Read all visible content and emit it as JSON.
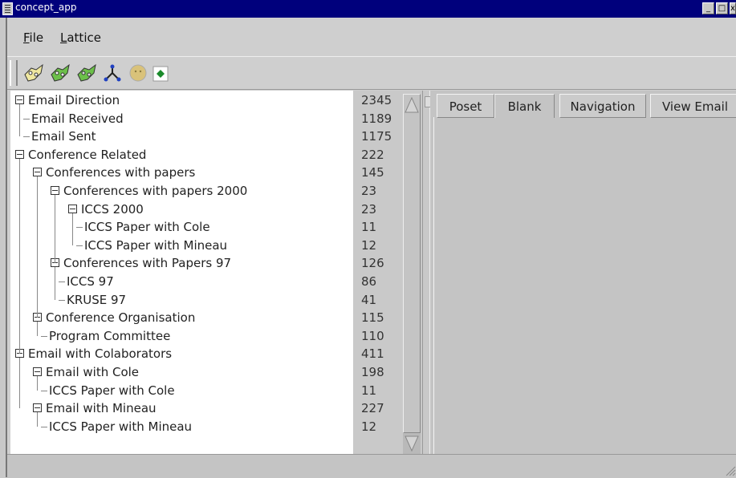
{
  "window": {
    "title": "concept_app"
  },
  "menubar": {
    "items": [
      "File",
      "Lattice"
    ]
  },
  "toolbar": {
    "icons": [
      "open-diagram-icon",
      "open-green-diagram-icon",
      "green-diagram-icon",
      "lattice-icon",
      "blank-face-icon",
      "green-dot-icon"
    ]
  },
  "tree": {
    "rows": [
      {
        "label": "Email Direction",
        "count": "2345"
      },
      {
        "label": "Email Received",
        "count": "1189"
      },
      {
        "label": "Email Sent",
        "count": "1175"
      },
      {
        "label": "Conference Related",
        "count": "222"
      },
      {
        "label": "Conferences with papers",
        "count": "145"
      },
      {
        "label": "Conferences with papers 2000",
        "count": "23"
      },
      {
        "label": "ICCS 2000",
        "count": "23"
      },
      {
        "label": "ICCS Paper with Cole",
        "count": "11"
      },
      {
        "label": "ICCS Paper with Mineau",
        "count": "12"
      },
      {
        "label": "Conferences with Papers 97",
        "count": "126"
      },
      {
        "label": "ICCS 97",
        "count": "86"
      },
      {
        "label": "KRUSE 97",
        "count": "41"
      },
      {
        "label": "Conference Organisation",
        "count": "115"
      },
      {
        "label": "Program Committee",
        "count": "110"
      },
      {
        "label": "Email with Colaborators",
        "count": "411"
      },
      {
        "label": "Email with Cole",
        "count": "198"
      },
      {
        "label": "ICCS Paper with Cole",
        "count": "11"
      },
      {
        "label": "Email with Mineau",
        "count": "227"
      },
      {
        "label": "ICCS Paper with Mineau",
        "count": "12"
      }
    ]
  },
  "tabs": [
    {
      "label": "Poset"
    },
    {
      "label": "Blank"
    },
    {
      "label": "Navigation"
    },
    {
      "label": "View Email"
    }
  ],
  "colors": {
    "titlebar": "#00007c",
    "panel": "#c4c4c4",
    "tree_bg": "#ffffff"
  }
}
